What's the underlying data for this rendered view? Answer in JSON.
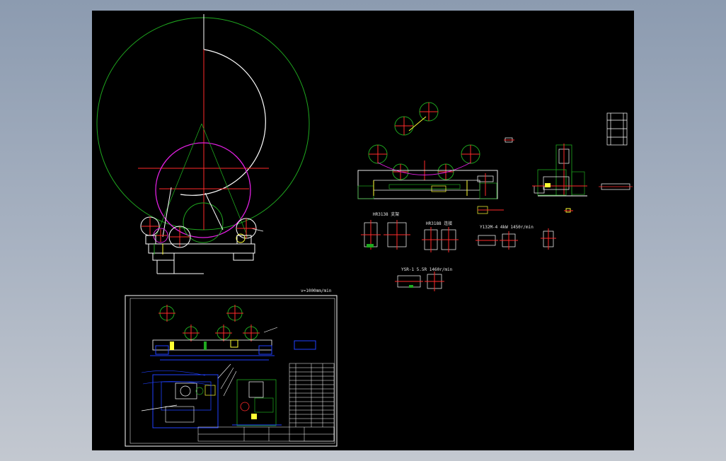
{
  "window": {
    "background": "#97a4b6"
  },
  "canvas": {
    "background": "#000000"
  },
  "colors": {
    "white": "#ffffff",
    "red": "#ff2a2a",
    "green": "#1fa81f",
    "magenta": "#e020e0",
    "yellow": "#ffff33",
    "blue": "#2040ff"
  },
  "labels": {
    "speed_note": "v=1000mm/min",
    "part_a": "HR3138 支架",
    "part_b": "HR3188 连接",
    "part_c": "Y132M-4 4kW 1450r/min",
    "part_d": "YSR-1 5.5R 1460r/min"
  }
}
